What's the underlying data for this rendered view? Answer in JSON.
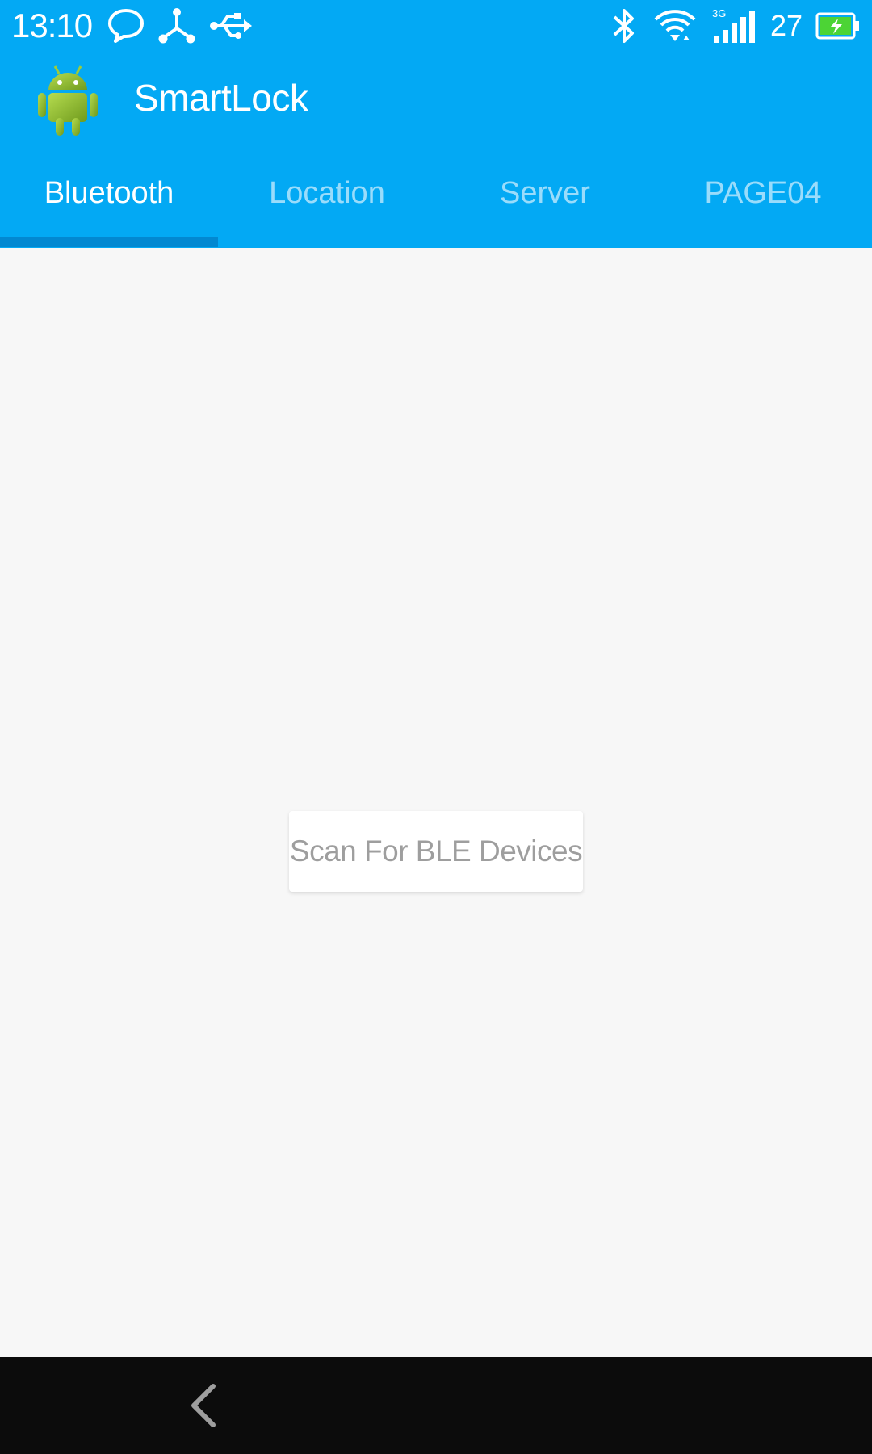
{
  "status_bar": {
    "time": "13:10",
    "battery_level": "27",
    "network_type": "3G",
    "icons_left": [
      "chat-bubble-icon",
      "share-hub-icon",
      "usb-icon"
    ],
    "icons_right": [
      "bluetooth-icon",
      "wifi-icon",
      "signal-icon",
      "battery-charging-icon"
    ]
  },
  "app_bar": {
    "title": "SmartLock",
    "logo": "android-robot-icon"
  },
  "tabs": [
    {
      "label": "Bluetooth",
      "active": true
    },
    {
      "label": "Location",
      "active": false
    },
    {
      "label": "Server",
      "active": false
    },
    {
      "label": "PAGE04",
      "active": false
    }
  ],
  "main": {
    "scan_button_label": "Scan For BLE Devices"
  },
  "nav_bar": {
    "back_icon": "back-chevron-icon"
  },
  "colors": {
    "primary": "#03a9f4",
    "tab_indicator": "#0288d1",
    "background": "#f7f7f7",
    "nav_bar": "#0c0c0c",
    "battery_fill": "#4cd435"
  }
}
